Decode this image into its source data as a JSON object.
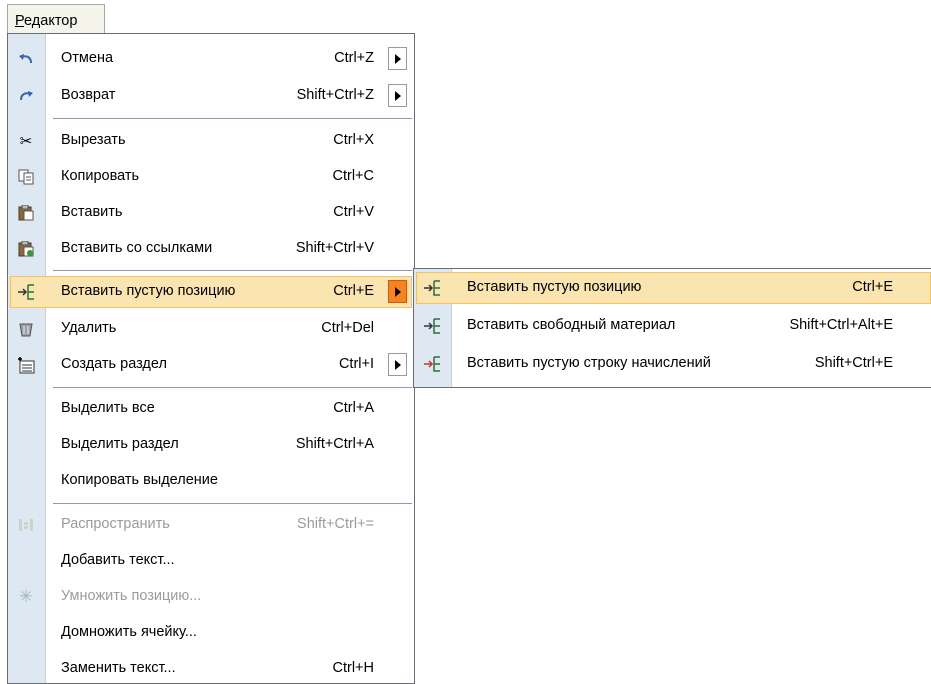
{
  "menubar": {
    "title_mnemonic": "Р",
    "title_rest": "едактор"
  },
  "menu": {
    "items": [
      {
        "label": "Отмена",
        "shortcut": "Ctrl+Z",
        "icon": "undo-icon"
      },
      {
        "label": "Возврат",
        "shortcut": "Shift+Ctrl+Z",
        "icon": "redo-icon"
      },
      {
        "label": "Вырезать",
        "shortcut": "Ctrl+X",
        "icon": "cut-icon"
      },
      {
        "label": "Копировать",
        "shortcut": "Ctrl+C",
        "icon": "copy-icon"
      },
      {
        "label": "Вставить",
        "shortcut": "Ctrl+V",
        "icon": "paste-icon"
      },
      {
        "label": "Вставить со ссылками",
        "shortcut": "Shift+Ctrl+V",
        "icon": "paste-links-icon"
      },
      {
        "label": "Вставить пустую позицию",
        "shortcut": "Ctrl+E",
        "icon": "insert-position-icon"
      },
      {
        "label": "Удалить",
        "shortcut": "Ctrl+Del",
        "icon": "trash-icon"
      },
      {
        "label": "Создать раздел",
        "shortcut": "Ctrl+I",
        "icon": "new-section-icon"
      },
      {
        "label": "Выделить все",
        "shortcut": "Ctrl+A"
      },
      {
        "label": "Выделить раздел",
        "shortcut": "Shift+Ctrl+A"
      },
      {
        "label": "Копировать выделение",
        "shortcut": ""
      },
      {
        "label": "Распространить",
        "shortcut": "Shift+Ctrl+=",
        "icon": "spread-icon"
      },
      {
        "label": "Добавить текст...",
        "shortcut": ""
      },
      {
        "label": "Умножить позицию...",
        "shortcut": "",
        "icon": "multiply-icon"
      },
      {
        "label": "Домножить ячейку...",
        "shortcut": ""
      },
      {
        "label": "Заменить текст...",
        "shortcut": "Ctrl+H"
      }
    ]
  },
  "submenu": {
    "items": [
      {
        "label": "Вставить пустую позицию",
        "shortcut": "Ctrl+E",
        "icon": "insert-position-icon"
      },
      {
        "label": "Вставить свободный материал",
        "shortcut": "Shift+Ctrl+Alt+E",
        "icon": "insert-material-icon"
      },
      {
        "label": "Вставить пустую строку начислений",
        "shortcut": "Shift+Ctrl+E",
        "icon": "insert-charge-row-icon"
      }
    ]
  },
  "colors": {
    "highlight": "#fae4b0",
    "highlight_border": "#f2c265",
    "arrow_active": "#f5831f",
    "icon_strip": "#dde8f2"
  }
}
